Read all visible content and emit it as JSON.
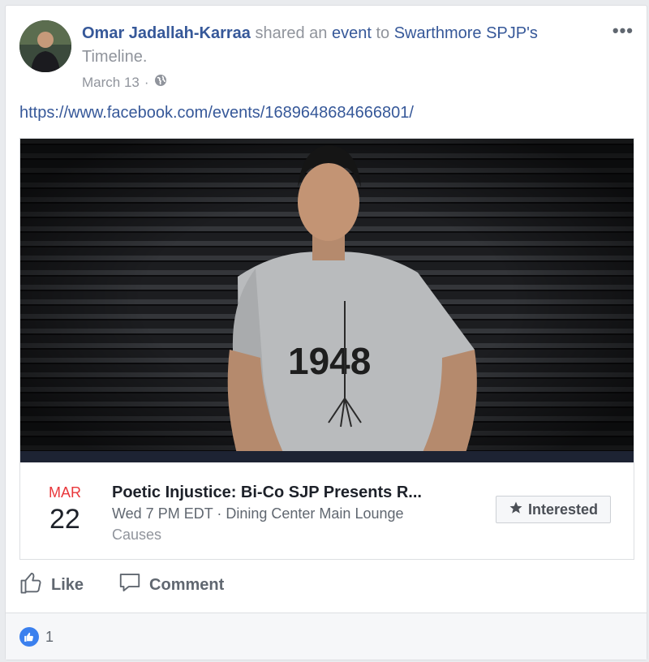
{
  "post": {
    "author": "Omar Jadallah-Karraa",
    "shared_text": " shared an ",
    "event_link": "event",
    "to_text": " to ",
    "target": "Swarthmore SPJP's",
    "timeline_text": " Timeline.",
    "date": "March 13",
    "separator": " · ",
    "privacy_icon": "globe-icon",
    "options": "•••",
    "url": "https://www.facebook.com/events/1689648684666801/"
  },
  "event": {
    "month": "MAR",
    "day": "22",
    "title": "Poetic Injustice: Bi-Co SJP Presents R...",
    "details": "Wed 7 PM EDT · Dining Center Main Lounge",
    "category": "Causes",
    "interested_label": "Interested",
    "interested_icon": "star-icon",
    "photo_shirt_text": "1948",
    "month_color": "#e9373b"
  },
  "actions": {
    "like_label": "Like",
    "comment_label": "Comment"
  },
  "reactions": {
    "count": "1",
    "icon": "thumbs-up-icon",
    "color": "#3b80ee"
  }
}
